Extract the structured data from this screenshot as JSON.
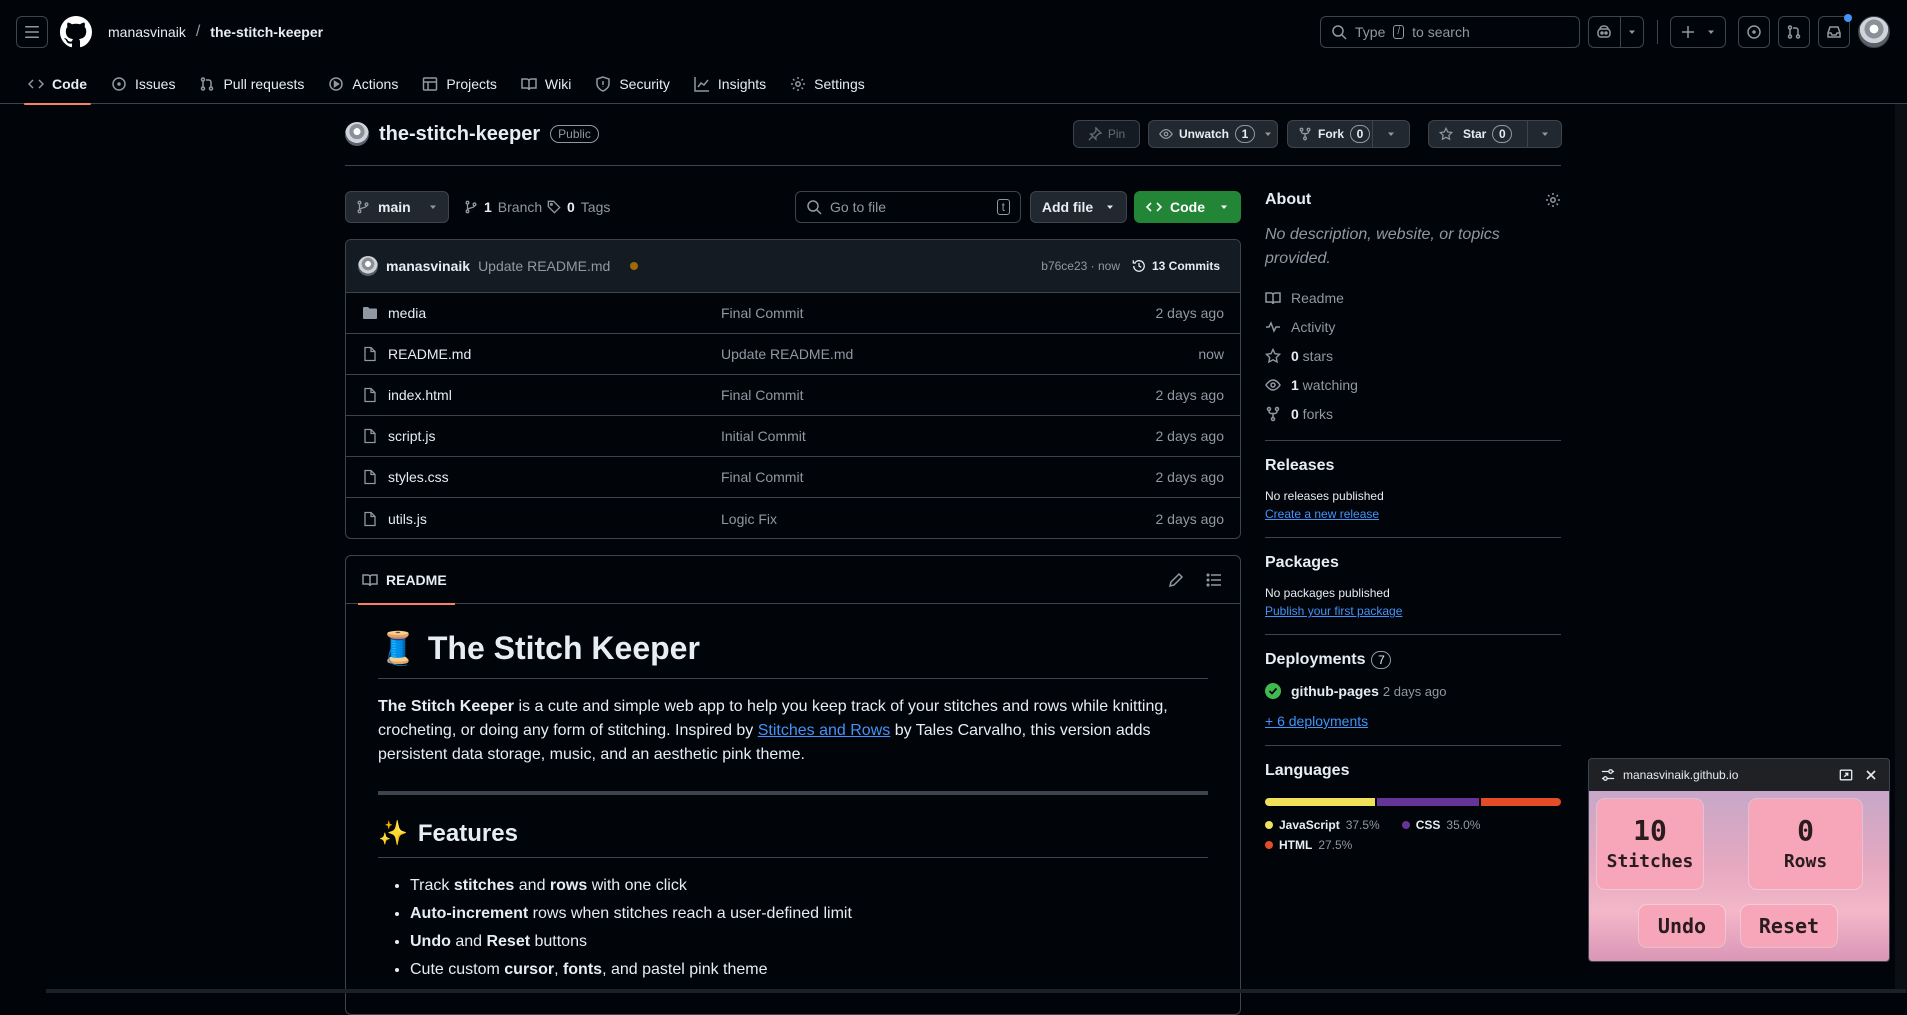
{
  "header": {
    "owner": "manasvinaik",
    "separator": "/",
    "repo": "the-stitch-keeper",
    "search_placeholder_prefix": "Type",
    "search_key": "/",
    "search_placeholder_suffix": "to search"
  },
  "tabs": [
    {
      "label": "Code",
      "icon": "code-icon",
      "active": true
    },
    {
      "label": "Issues",
      "icon": "issue-icon"
    },
    {
      "label": "Pull requests",
      "icon": "pull-request-icon"
    },
    {
      "label": "Actions",
      "icon": "play-icon"
    },
    {
      "label": "Projects",
      "icon": "table-icon"
    },
    {
      "label": "Wiki",
      "icon": "book-icon"
    },
    {
      "label": "Security",
      "icon": "shield-icon"
    },
    {
      "label": "Insights",
      "icon": "graph-icon"
    },
    {
      "label": "Settings",
      "icon": "gear-icon"
    }
  ],
  "repo": {
    "name": "the-stitch-keeper",
    "visibility": "Public",
    "pin_label": "Pin",
    "unwatch_label": "Unwatch",
    "watch_count": "1",
    "fork_label": "Fork",
    "fork_count": "0",
    "star_label": "Star",
    "star_count": "0"
  },
  "toolbar": {
    "branch": "main",
    "branches_count": "1",
    "branches_label": "Branch",
    "tags_count": "0",
    "tags_label": "Tags",
    "goto_placeholder": "Go to file",
    "goto_key": "t",
    "add_file_label": "Add file",
    "code_label": "Code"
  },
  "commit": {
    "author": "manasvinaik",
    "message": "Update README.md",
    "hash": "b76ce23 · now",
    "commits_label": "13 Commits"
  },
  "files": [
    {
      "name": "media",
      "type": "folder",
      "message": "Final Commit",
      "date": "2 days ago"
    },
    {
      "name": "README.md",
      "type": "file",
      "message": "Update README.md",
      "date": "now"
    },
    {
      "name": "index.html",
      "type": "file",
      "message": "Final Commit",
      "date": "2 days ago"
    },
    {
      "name": "script.js",
      "type": "file",
      "message": "Initial Commit",
      "date": "2 days ago"
    },
    {
      "name": "styles.css",
      "type": "file",
      "message": "Final Commit",
      "date": "2 days ago"
    },
    {
      "name": "utils.js",
      "type": "file",
      "message": "Logic Fix",
      "date": "2 days ago"
    }
  ],
  "readme": {
    "tab_label": "README",
    "title_emoji": "🧵",
    "title": "The Stitch Keeper",
    "intro_bold": "The Stitch Keeper",
    "intro_1": " is a cute and simple web app to help you keep track of your stitches and rows while knitting, crocheting, or doing any form of stitching. Inspired by ",
    "intro_link": "Stitches and Rows",
    "intro_2": " by Tales Carvalho, this version adds persistent data storage, music, and an aesthetic pink theme.",
    "features_emoji": "✨",
    "features_title": "Features",
    "features": [
      {
        "a": "Track ",
        "b": "stitches",
        "c": " and ",
        "d": "rows",
        "e": " with one click"
      },
      {
        "a": "",
        "b": "Auto-increment",
        "c": " rows when stitches reach a user-defined limit",
        "d": "",
        "e": ""
      },
      {
        "a": "",
        "b": "Undo",
        "c": " and ",
        "d": "Reset",
        "e": " buttons"
      },
      {
        "a": "Cute custom ",
        "b": "cursor",
        "c": ", ",
        "d": "fonts",
        "e": ", and pastel pink theme"
      }
    ]
  },
  "about": {
    "title": "About",
    "description": "No description, website, or topics provided.",
    "items": [
      {
        "icon": "book-icon",
        "bold": "",
        "text": "Readme"
      },
      {
        "icon": "pulse-icon",
        "bold": "",
        "text": "Activity"
      },
      {
        "icon": "star-icon",
        "bold": "0",
        "text": " stars"
      },
      {
        "icon": "eye-icon",
        "bold": "1",
        "text": " watching"
      },
      {
        "icon": "fork-icon",
        "bold": "0",
        "text": " forks"
      }
    ]
  },
  "releases": {
    "title": "Releases",
    "empty": "No releases published",
    "link": "Create a new release"
  },
  "packages": {
    "title": "Packages",
    "empty": "No packages published",
    "link": "Publish your first package"
  },
  "deployments": {
    "title": "Deployments",
    "count": "7",
    "env": "github-pages",
    "time": "2 days ago",
    "more": "+ 6 deployments"
  },
  "languages": {
    "title": "Languages",
    "list": [
      {
        "name": "JavaScript",
        "percent": "37.5%",
        "value": 37.5,
        "color": "#f1e05a"
      },
      {
        "name": "CSS",
        "percent": "35.0%",
        "value": 35.0,
        "color": "#663399"
      },
      {
        "name": "HTML",
        "percent": "27.5%",
        "value": 27.5,
        "color": "#e34c26"
      }
    ]
  },
  "pip": {
    "url": "manasvinaik.github.io",
    "stitches_value": "10",
    "stitches_label": "Stitches",
    "rows_value": "0",
    "rows_label": "Rows",
    "undo_label": "Undo",
    "reset_label": "Reset"
  }
}
